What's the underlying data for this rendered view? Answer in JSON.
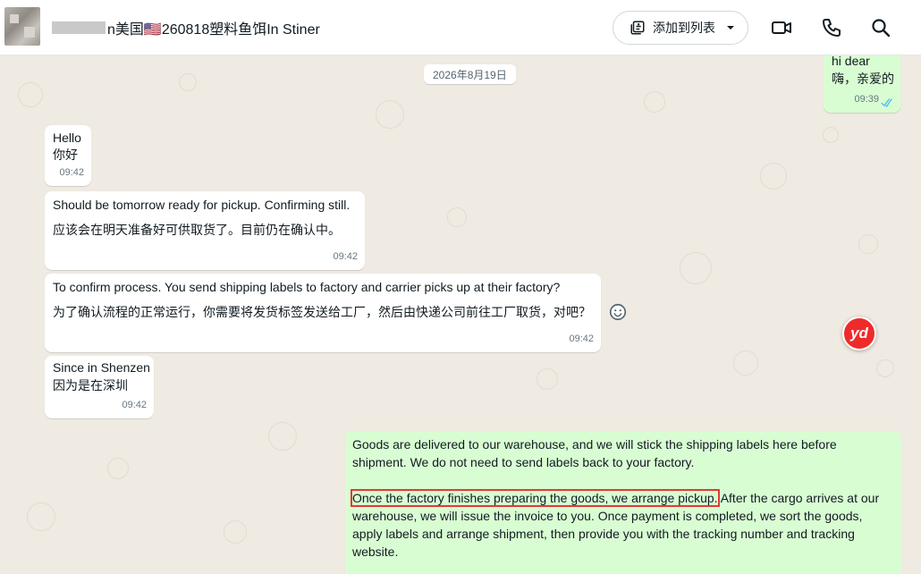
{
  "header": {
    "title": "n美国🇺🇸260818塑料鱼饵In Stiner",
    "add_to_list_label": "添加到列表"
  },
  "date_chip": "2026年8月19日",
  "messages": {
    "out_top": {
      "line1": "hi dear",
      "line2": "嗨，亲爱的",
      "time": "09:39"
    },
    "in1": {
      "line1": "Hello",
      "line2": "你好",
      "time": "09:42"
    },
    "in2": {
      "line1": "Should be tomorrow ready for pickup. Confirming still.",
      "line2": "应该会在明天准备好可供取货了。目前仍在确认中。",
      "time": "09:42"
    },
    "in3": {
      "line1": "To confirm process. You send shipping labels to factory and carrier picks up at their factory?",
      "line2": "为了确认流程的正常运行，你需要将发货标签发送给工厂，然后由快递公司前往工厂取货，对吧？",
      "time": "09:42"
    },
    "in4": {
      "line1": "Since in Shenzen",
      "line2": "因为是在深圳",
      "time": "09:42"
    },
    "out_bottom": {
      "p1_line1": "Goods are delivered to our warehouse, and we will stick the shipping labels here before",
      "p1_line2": "shipment. We do not need to send labels back to your factory.",
      "p2_highlight": "Once the factory finishes preparing the goods, we arrange pickup.",
      "p2_line1_rest": " After the cargo arrives at our",
      "p2_line2": "warehouse, we will issue the invoice to you. Once payment is completed, we sort the goods,",
      "p2_line3": "apply labels and arrange shipment, then provide you with the tracking number and tracking",
      "p2_line4": "website."
    }
  },
  "badge": {
    "label": "yd"
  },
  "colors": {
    "outgoing_bubble": "#d9fdd3",
    "incoming_bubble": "#ffffff",
    "read_ticks": "#53bdeb",
    "highlight_box": "#e53935"
  }
}
